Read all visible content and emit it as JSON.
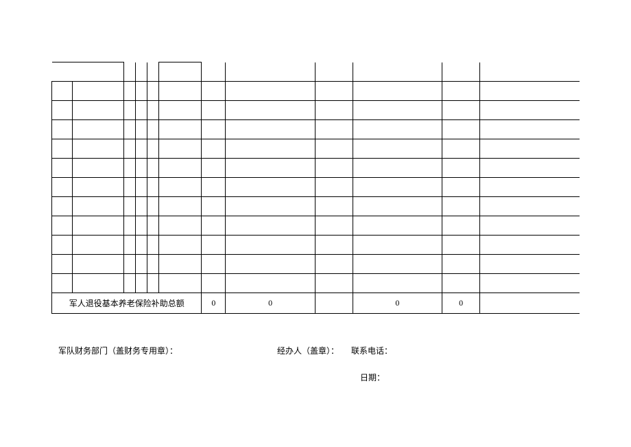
{
  "table": {
    "summary_label": "军人退役基本养老保险补助总额",
    "summary_values": [
      "0",
      "0",
      "0",
      "0",
      ""
    ]
  },
  "footer": {
    "dept_label": "军队财务部门（盖财务专用章）：",
    "handler_label": "经办人（盖章）：",
    "phone_label": "联系电话：",
    "date_label": "日期："
  }
}
